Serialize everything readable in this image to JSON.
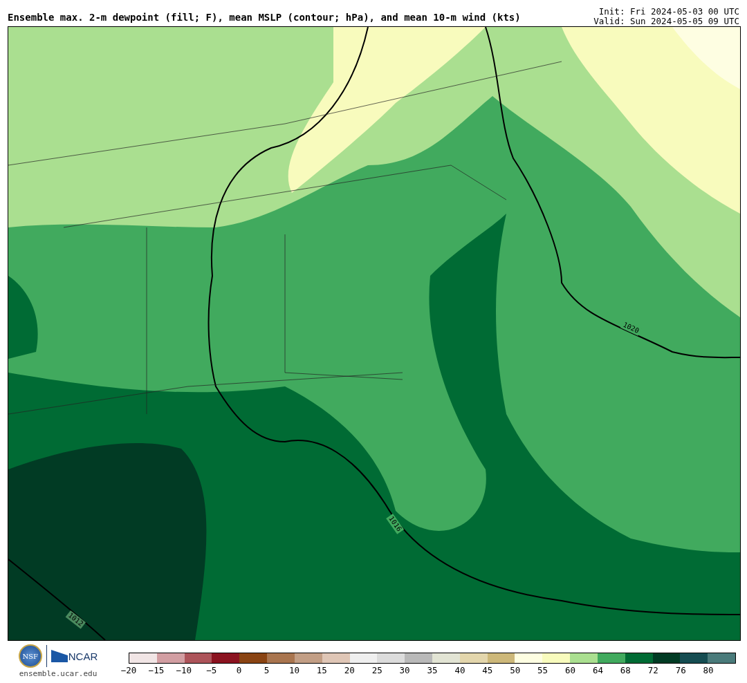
{
  "title": "Ensemble max. 2-m dewpoint (fill; F), mean MSLP (contour; hPa), and mean 10-m wind (kts)",
  "init": "Init: Fri 2024-05-03 00 UTC",
  "valid": "Valid: Sun 2024-05-05 09 UTC",
  "map": {
    "contour_labels": [
      "1020",
      "1016",
      "1012"
    ]
  },
  "logo": {
    "nsf": "NSF",
    "ncar": "NCAR",
    "url": "ensemble.ucar.edu"
  },
  "colorbar": {
    "swatches": [
      {
        "color": "#f1e5e5"
      },
      {
        "color": "#d29ea2"
      },
      {
        "color": "#ad545a"
      },
      {
        "color": "#8b1320"
      },
      {
        "color": "#8a4413"
      },
      {
        "color": "#a9754f"
      },
      {
        "color": "#c29e85"
      },
      {
        "color": "#dfc6b6"
      },
      {
        "color": "#efefef"
      },
      {
        "color": "#dcdcdc"
      },
      {
        "color": "#b9b9b9"
      },
      {
        "color": "#e2e4d4"
      },
      {
        "color": "#e3d6ac"
      },
      {
        "color": "#cdb87a"
      },
      {
        "color": "#fefee2"
      },
      {
        "color": "#f8fbbd"
      },
      {
        "color": "#aadf90"
      },
      {
        "color": "#41aa5e"
      },
      {
        "color": "#006b34"
      },
      {
        "color": "#013b24"
      },
      {
        "color": "#164d52"
      },
      {
        "color": "#4a7b7b"
      }
    ],
    "ticks": [
      "−20",
      "−15",
      "−10",
      "−5",
      "0",
      "5",
      "10",
      "15",
      "20",
      "25",
      "30",
      "35",
      "40",
      "45",
      "50",
      "55",
      "60",
      "64",
      "68",
      "72",
      "76",
      "80"
    ]
  }
}
